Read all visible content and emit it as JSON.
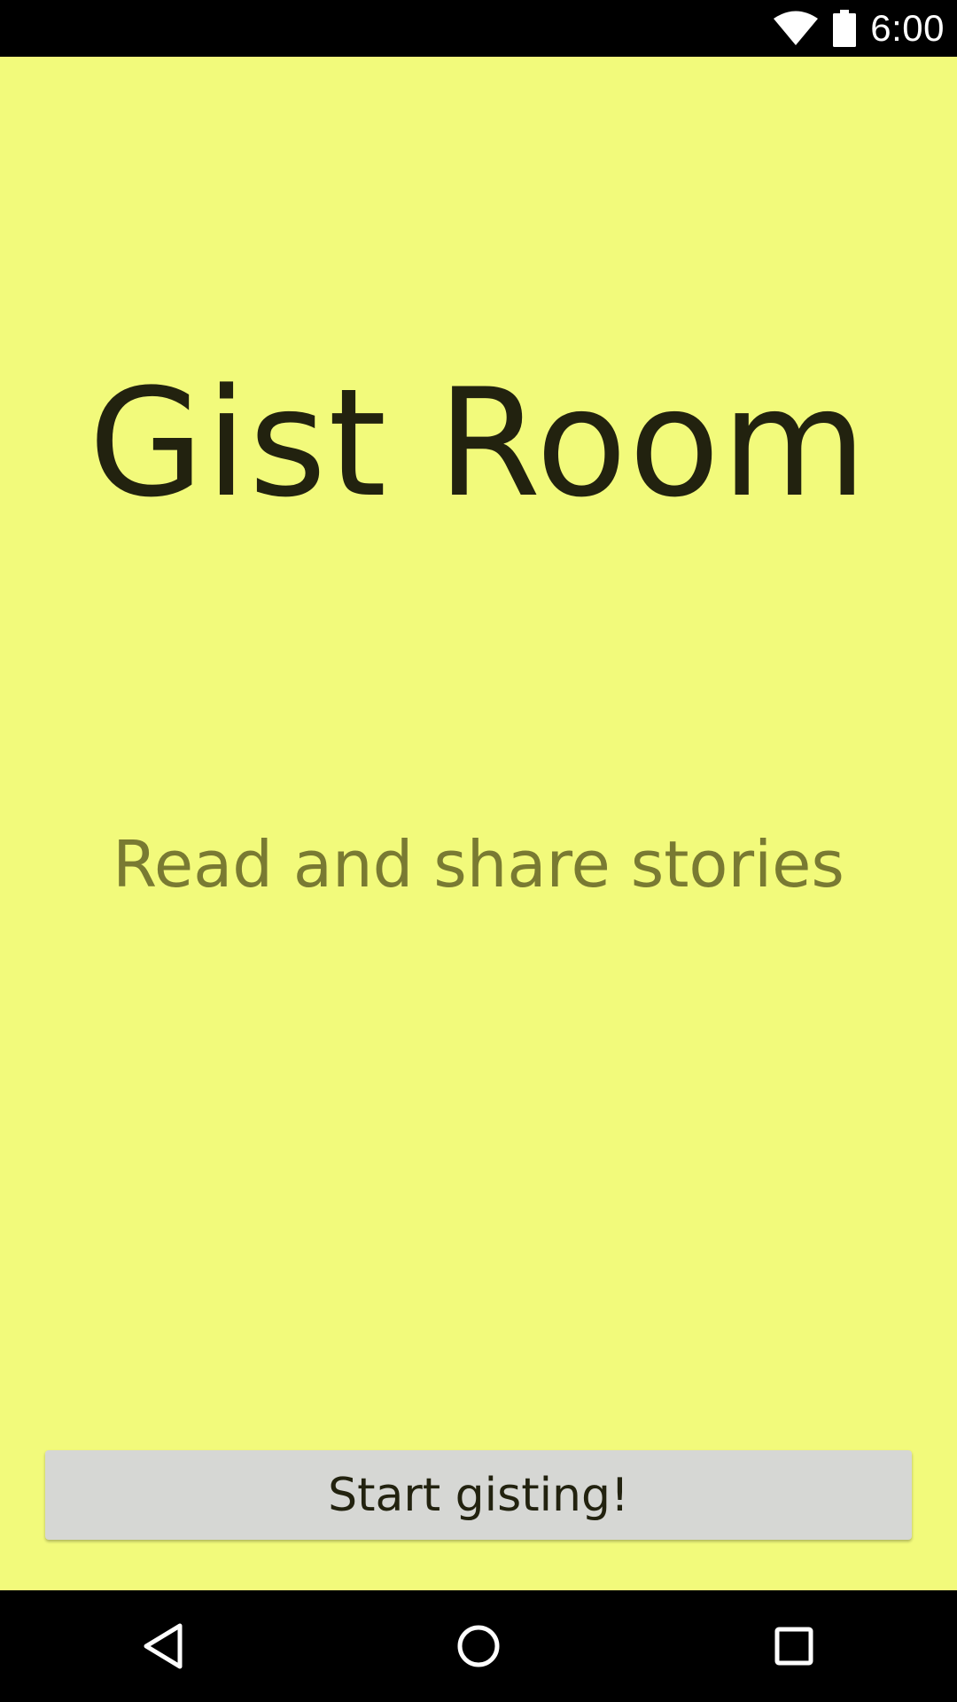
{
  "status_bar": {
    "time": "6:00",
    "icons": [
      "wifi-icon",
      "battery-icon"
    ]
  },
  "main": {
    "title": "Gist Room",
    "subtitle": "Read and share stories",
    "start_button_label": "Start gisting!"
  },
  "nav_bar": {
    "icons": [
      "back-icon",
      "home-icon",
      "recents-icon"
    ]
  },
  "colors": {
    "background": "#f2fa7b",
    "title_text": "#22220f",
    "subtitle_text": "#797a32",
    "button_bg": "#d6d7d4"
  }
}
